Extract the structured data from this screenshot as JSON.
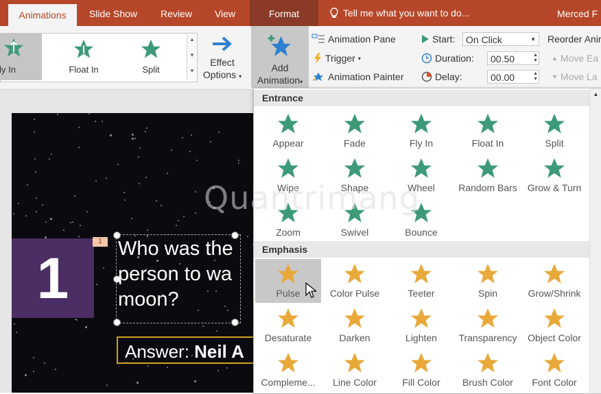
{
  "tabs": {
    "animations": "Animations",
    "slideshow": "Slide Show",
    "review": "Review",
    "view": "View",
    "format": "Format",
    "tell_me": "Tell me what you want to do...",
    "user": "Merced F"
  },
  "ribbon": {
    "gallery": [
      "Fly In",
      "Float In",
      "Split"
    ],
    "effect_options_1": "Effect",
    "effect_options_2": "Options",
    "add_animation_1": "Add",
    "add_animation_2": "Animation",
    "animation_pane": "Animation Pane",
    "trigger": "Trigger",
    "animation_painter": "Animation Painter",
    "start_label": "Start:",
    "start_value": "On Click",
    "duration_label": "Duration:",
    "duration_value": "00.50",
    "delay_label": "Delay:",
    "delay_value": "00.00",
    "reorder": "Reorder Anir",
    "move_earlier": "Move Ea",
    "move_later": "Move La",
    "group_label": "ation"
  },
  "slide": {
    "number": "1",
    "tag": "1",
    "question": "Who was the\nperson to wa\nmoon?",
    "answer_prefix": "Answer: ",
    "answer_bold": "Neil A"
  },
  "dropdown": {
    "entrance_header": "Entrance",
    "emphasis_header": "Emphasis",
    "entrance": [
      "Appear",
      "Fade",
      "Fly In",
      "Float In",
      "Split",
      "Wipe",
      "Shape",
      "Wheel",
      "Random Bars",
      "Grow & Turn",
      "Zoom",
      "Swivel",
      "Bounce"
    ],
    "emphasis": [
      "Pulse",
      "Color Pulse",
      "Teeter",
      "Spin",
      "Grow/Shrink",
      "Desaturate",
      "Darken",
      "Lighten",
      "Transparency",
      "Object Color",
      "Compleme...",
      "Line Color",
      "Fill Color",
      "Brush Color",
      "Font Color"
    ]
  },
  "watermark": "Quantrimang",
  "colors": {
    "accent": "#b7472a",
    "entrance_star": "#3d9a78",
    "emphasis_star": "#e8a93a",
    "slide_box": "#4a2e64",
    "answer_border": "#d4a020"
  }
}
